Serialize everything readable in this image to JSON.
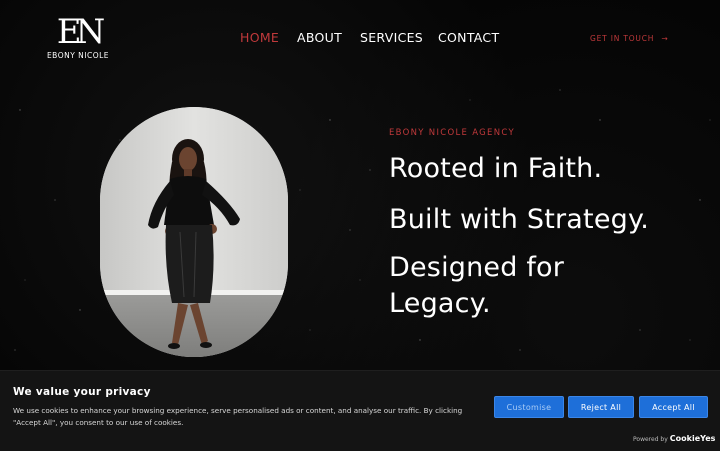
{
  "brand": {
    "logo_mark": "EN",
    "logo_text": "EBONY NICOLE"
  },
  "nav": {
    "items": [
      {
        "label": "HOME",
        "active": true
      },
      {
        "label": "ABOUT",
        "active": false
      },
      {
        "label": "SERVICES",
        "active": false
      },
      {
        "label": "CONTACT",
        "active": false
      }
    ],
    "cta_label": "GET IN TOUCH",
    "cta_arrow": "→"
  },
  "hero": {
    "eyebrow": "EBONY NICOLE AGENCY",
    "headline_lines": [
      "Rooted in Faith.",
      "Built with Strategy.",
      "Designed for",
      "Legacy."
    ]
  },
  "cookie_banner": {
    "title": "We value your privacy",
    "text": "We use cookies to enhance your browsing experience, serve personalised ads or content, and analyse our traffic. By clicking \"Accept All\", you consent to our use of cookies.",
    "customise_label": "Customise",
    "reject_label": "Reject All",
    "accept_label": "Accept All",
    "powered_by": "Powered by",
    "powered_brand": "CookieYes"
  },
  "colors": {
    "accent": "#c0393b",
    "background": "#050505",
    "button_blue": "#1e6fd9"
  }
}
